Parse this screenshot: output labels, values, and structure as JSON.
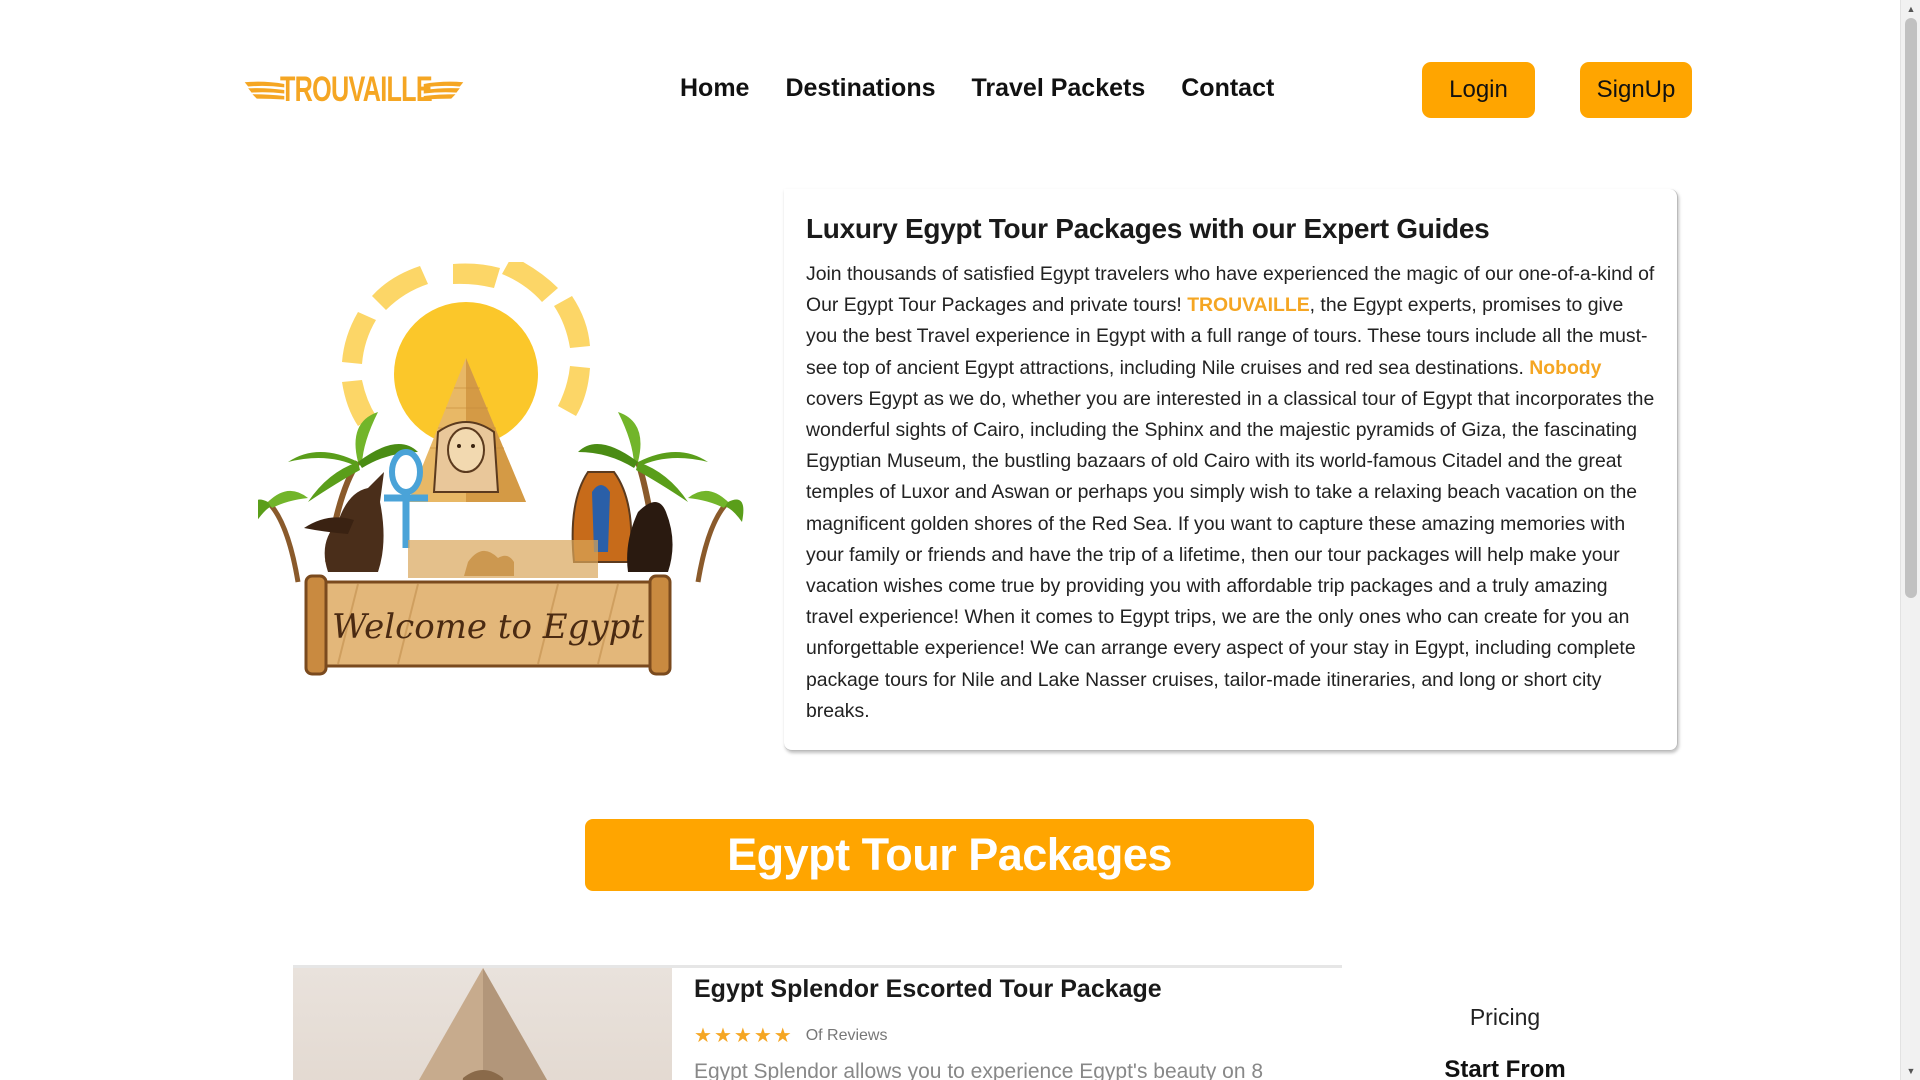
{
  "header": {
    "brand": "TROUVAILLE",
    "nav": [
      "Home",
      "Destinations",
      "Travel Packets",
      "Contact"
    ],
    "login_label": "Login",
    "signup_label": "SignUp"
  },
  "hero": {
    "illustration_text": "Welcome to Egypt",
    "title": "Luxury Egypt Tour Packages with our Expert Guides",
    "para_1": "Join thousands of satisfied Egypt travelers who have experienced the magic of our one-of-a-kind of Our Egypt Tour Packages and private tours! ",
    "highlight_1": "TROUVAILLE",
    "para_2": ", the Egypt experts, promises to give you the best Travel experience in Egypt with a full range of tours. These tours include all the must-see top of ancient Egypt attractions, including Nile cruises and red sea destinations. ",
    "highlight_2": "Nobody",
    "para_3": " covers Egypt as we do, whether you are interested in a classical tour of Egypt that incorporates the wonderful sights of Cairo, including the Sphinx and the majestic pyramids of Giza, the fascinating Egyptian Museum, the bustling bazaars of old Cairo with its world-famous Citadel and the great temples of Luxor and Aswan or perhaps you simply wish to take a relaxing beach vacation on the magnificent golden shores of the Red Sea. If you want to capture these amazing memories with your family or friends and have the trip of a lifetime, then our tour packages will help make your vacation wishes come true by providing you with affordable trip packages and a truly amazing travel experience! When it comes to Egypt trips, we are the only ones who can create for you an unforgettable experience! We can arrange every aspect of your stay in Egypt, including complete package tours for Nile and Lake Nasser cruises, tailor-made itineraries, and long or short city breaks."
  },
  "packages": {
    "banner": "Egypt Tour Packages",
    "items": [
      {
        "title": "Egypt Splendor Escorted Tour Package",
        "rating": 5,
        "reviews_label": "Of Reviews",
        "description": "Egypt Splendor allows you to experience Egypt's beauty on 8",
        "pricing_label": "Pricing",
        "start_from_label": "Start From"
      }
    ]
  },
  "colors": {
    "accent": "#ffa500",
    "brand": "#f5a623"
  },
  "icons": {
    "star": "star-icon",
    "logo_wing": "wing-icon"
  }
}
